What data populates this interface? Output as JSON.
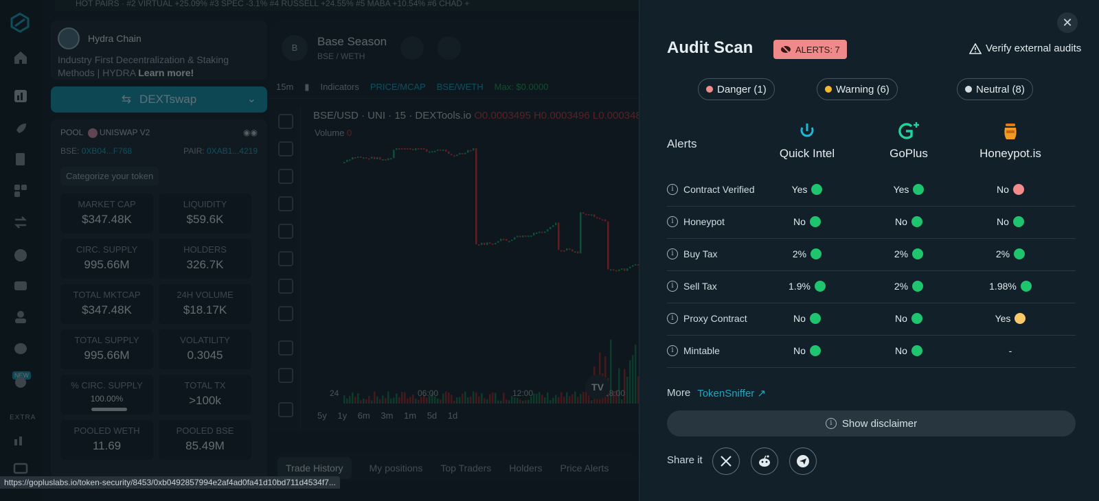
{
  "underlay": {
    "ticker": "HOT PAIRS   ·   #2 VIRTUAL +25.09%   #3 SPEC -3.1%   #4 RUSSELL +24.55%   #5 MABA +10.54%   #6 CHAD +",
    "nav_badge": "NEW",
    "nav_section": "EXTRA",
    "promo": {
      "name": "Hydra Chain",
      "desc": "Industry First Decentralization & Staking Methods | HYDRA",
      "learn_more": "Learn more!"
    },
    "dex_button": "DEXTswap",
    "pool": {
      "label": "POOL",
      "dex": "UNISWAP V2",
      "bse_label": "BSE:",
      "bse_addr": "0XB04...F768",
      "pair_label": "PAIR:",
      "pair_addr": "0XAB1...4219",
      "categorize": "Categorize your token",
      "stats": [
        {
          "k": "MARKET CAP",
          "v": "$347.48K"
        },
        {
          "k": "LIQUIDITY",
          "v": "$59.6K"
        },
        {
          "k": "CIRC. SUPPLY",
          "v": "995.66M"
        },
        {
          "k": "HOLDERS",
          "v": "326.7K"
        },
        {
          "k": "TOTAL MKTCAP",
          "v": "$347.48K"
        },
        {
          "k": "24H VOLUME",
          "v": "$18.17K"
        },
        {
          "k": "TOTAL SUPPLY",
          "v": "995.66M"
        },
        {
          "k": "VOLATILITY",
          "v": "0.3045"
        },
        {
          "k": "% CIRC. SUPPLY",
          "v": "100.00%"
        },
        {
          "k": "TOTAL TX",
          "v": ">100k"
        },
        {
          "k": "POOLED WETH",
          "v": "11.69"
        },
        {
          "k": "POOLED BSE",
          "v": "85.49M"
        }
      ]
    },
    "chart": {
      "avatar": "B",
      "token_name": "Base Season",
      "pair_base": "BSE",
      "pair_quote": "/ WETH",
      "toolbar": [
        "15m",
        "Indicators",
        "PRICE/MCAP",
        "BSE/WETH",
        "Max: $0.0000"
      ],
      "ohlc_prefix": "BSE/USD · UNI · 15 · DEXTools.io",
      "ohlc": "O0.0003495 H0.0003496 L0.0003482",
      "volume_label": "Volume",
      "volume_value": "0",
      "xaxis": [
        "24",
        "06:00",
        "12:00",
        "18:00"
      ],
      "ranges": "5y 1y 6m 3m 1m 5d 1d",
      "tabs": [
        "Trade History",
        "My positions",
        "Top Traders",
        "Holders",
        "Price Alerts"
      ]
    },
    "status_url": "https://gopluslabs.io/token-security/8453/0xb0492857994e2af4ad0fa41d10bd711d4534f7..."
  },
  "audit": {
    "title": "Audit Scan",
    "alerts_badge": "ALERTS: 7",
    "verify_link": "Verify external audits",
    "filters": [
      {
        "label": "Danger (1)",
        "color": "#f28b8b"
      },
      {
        "label": "Warning (6)",
        "color": "#f5b82e"
      },
      {
        "label": "Neutral (8)",
        "color": "#d6dde0"
      }
    ],
    "alerts_heading": "Alerts",
    "providers": [
      "Quick Intel",
      "GoPlus",
      "Honeypot.is"
    ],
    "rows": [
      {
        "label": "Contract Verified",
        "cells": [
          {
            "v": "Yes",
            "s": "green"
          },
          {
            "v": "Yes",
            "s": "green"
          },
          {
            "v": "No",
            "s": "red"
          }
        ]
      },
      {
        "label": "Honeypot",
        "cells": [
          {
            "v": "No",
            "s": "green"
          },
          {
            "v": "No",
            "s": "green"
          },
          {
            "v": "No",
            "s": "green"
          }
        ]
      },
      {
        "label": "Buy Tax",
        "cells": [
          {
            "v": "2%",
            "s": "green"
          },
          {
            "v": "2%",
            "s": "green"
          },
          {
            "v": "2%",
            "s": "green"
          }
        ]
      },
      {
        "label": "Sell Tax",
        "cells": [
          {
            "v": "1.9%",
            "s": "green"
          },
          {
            "v": "2%",
            "s": "green"
          },
          {
            "v": "1.98%",
            "s": "green"
          }
        ]
      },
      {
        "label": "Proxy Contract",
        "cells": [
          {
            "v": "No",
            "s": "green"
          },
          {
            "v": "No",
            "s": "green"
          },
          {
            "v": "Yes",
            "s": "yellow"
          }
        ]
      },
      {
        "label": "Mintable",
        "cells": [
          {
            "v": "No",
            "s": "green"
          },
          {
            "v": "No",
            "s": "green"
          },
          {
            "v": "-",
            "s": "none"
          }
        ]
      }
    ],
    "status_colors": {
      "green": "#1fc46e",
      "red": "#f28b8b",
      "yellow": "#f7c96a"
    },
    "more_label": "More",
    "more_link": "TokenSniffer",
    "disclaimer": "Show disclaimer",
    "share_label": "Share it",
    "share_icons": [
      "x-icon",
      "reddit-icon",
      "telegram-icon"
    ]
  }
}
